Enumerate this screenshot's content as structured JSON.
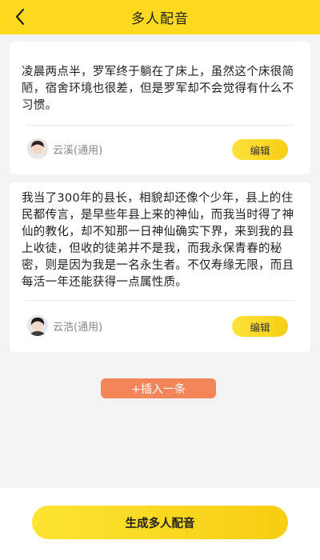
{
  "header": {
    "title": "多人配音",
    "back_icon": "chevron-left-icon"
  },
  "cards": [
    {
      "text": "凌晨两点半，罗军终于躺在了床上，虽然这个床很简陋，宿舍环境也很差，但是罗军却不会觉得有什么不习惯。",
      "voice": "云溪(通用)",
      "edit_label": "编辑"
    },
    {
      "text": " 我当了300年的县长，相貌却还像个少年，县上的住民都传言，是早些年县上来的神仙，而我当时得了神仙的教化，却不知那一日神仙确实下界，来到我的县上收徒，但收的徒弟并不是我，而我永保青春的秘密，则是因为我是一名永生者。不仅寿缘无限，而且每活一年还能获得一点属性质。",
      "voice": "云浩(通用)",
      "edit_label": "编辑"
    }
  ],
  "insert_label": "+插入一条",
  "generate_label": "生成多人配音",
  "colors": {
    "header": "#fbd91e",
    "accent_yellow": "#f7cf14",
    "insert_button": "#f2855a",
    "background": "#f3f3f3"
  }
}
